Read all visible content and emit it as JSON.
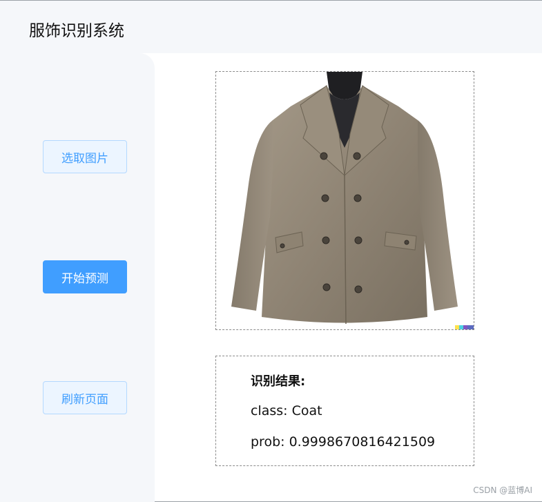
{
  "header": {
    "title": "服饰识别系统"
  },
  "sidebar": {
    "buttons": [
      {
        "label": "选取图片"
      },
      {
        "label": "开始预测"
      },
      {
        "label": "刷新页面"
      }
    ]
  },
  "preview": {
    "image": "coat-photo"
  },
  "result": {
    "heading": "识别结果:",
    "class_line": "class: Coat",
    "prob_line": "prob: 0.9998670816421509"
  },
  "watermark": "CSDN @蓝博AI",
  "colors": {
    "primary": "#409eff",
    "plain_bg": "#ecf5ff",
    "sidebar_bg": "#f5f7fa"
  }
}
